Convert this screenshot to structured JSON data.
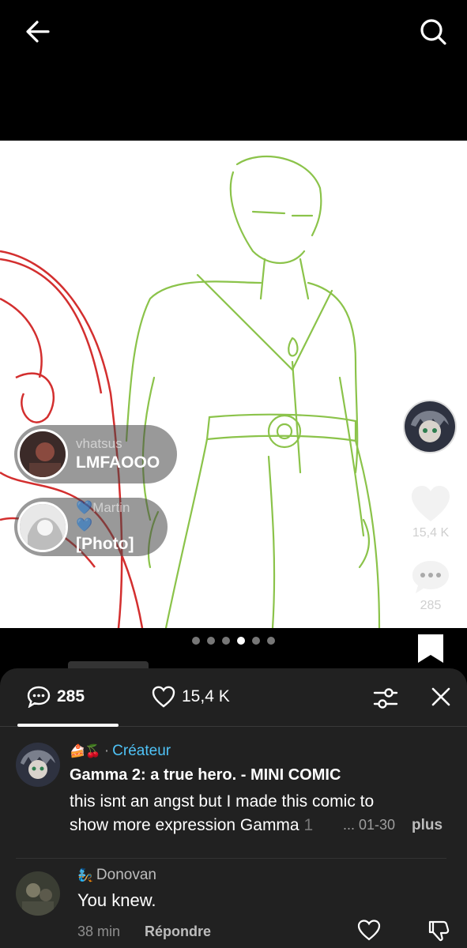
{
  "topbar": {
    "back_icon": "arrow-left-icon",
    "search_icon": "search-icon"
  },
  "bubbles": [
    {
      "username": "vhatsus",
      "message": "LMFAOOO"
    },
    {
      "username": "💙Martin💙",
      "message": "[Photo]"
    }
  ],
  "side": {
    "like_count": "15,4 K",
    "comment_count": "285"
  },
  "carousel": {
    "total": 6,
    "active_index": 3
  },
  "sheet": {
    "comments_count": "285",
    "likes_count": "15,4 K"
  },
  "comments": [
    {
      "badge": "🍰🍒",
      "sep": "·",
      "role": "Créateur",
      "title": "Gamma 2: a true hero. - MINI COMIC",
      "body_line1": "this isnt an angst but I made this comic to",
      "body_line2": "show more expression Gamma",
      "body_fade": "1",
      "date": "... 01-30",
      "more": "plus"
    },
    {
      "badge": "🧞",
      "username": "Donovan",
      "text": "You knew.",
      "time": "38 min",
      "reply": "Répondre"
    }
  ],
  "colors": {
    "sheet_bg": "#212121",
    "accent_blue": "#4fc3f7",
    "sketch_green": "#8bc34a",
    "sketch_red": "#d32f2f"
  }
}
